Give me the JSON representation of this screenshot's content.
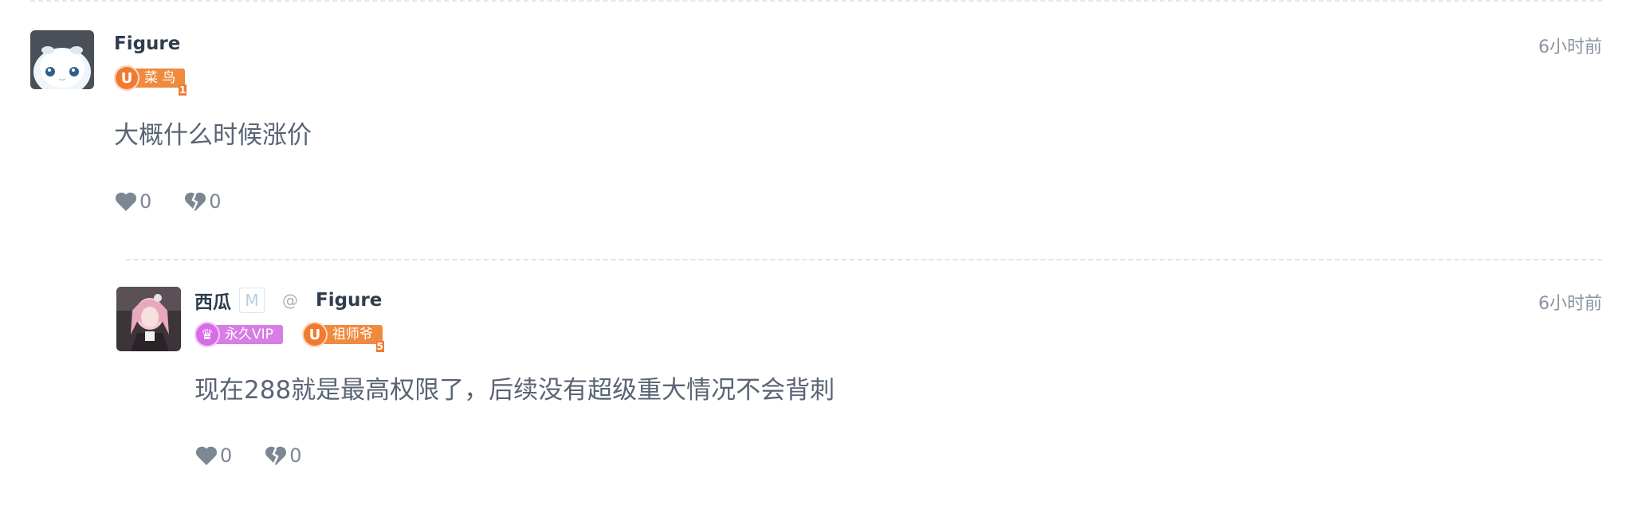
{
  "comment": {
    "username": "Figure",
    "time": "6小时前",
    "badges": [
      {
        "glyph": "U",
        "label": "菜 鸟",
        "level": "1",
        "color": "#f07a2f"
      }
    ],
    "text": "大概什么时候涨价",
    "likes": "0",
    "dislikes": "0"
  },
  "reply": {
    "username": "西瓜",
    "mod_tag": "M",
    "at_sign": "@",
    "reply_to": "Figure",
    "time": "6小时前",
    "badges": [
      {
        "glyph": "♛",
        "label": "永久VIP",
        "color": "#d86be6"
      },
      {
        "glyph": "U",
        "label": "祖师爷",
        "level": "5",
        "color": "#f07a2f"
      }
    ],
    "text": "现在288就是最高权限了，后续没有超级重大情况不会背刺",
    "likes": "0",
    "dislikes": "0"
  },
  "icons": {
    "like": "heart-icon",
    "dislike": "broken-heart-icon"
  }
}
